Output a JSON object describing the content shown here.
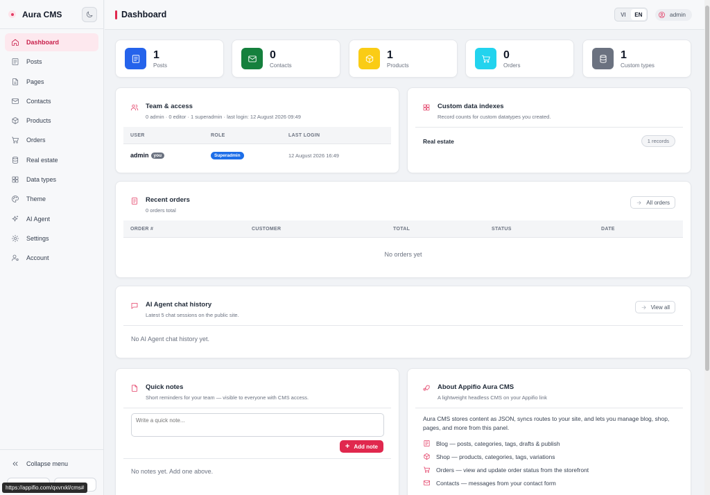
{
  "app": {
    "name": "Aura CMS"
  },
  "sidebar": {
    "items": [
      {
        "label": "Dashboard",
        "icon": "home-icon",
        "active": true
      },
      {
        "label": "Posts",
        "icon": "posts-icon"
      },
      {
        "label": "Pages",
        "icon": "page-icon"
      },
      {
        "label": "Contacts",
        "icon": "mail-icon"
      },
      {
        "label": "Products",
        "icon": "box-icon"
      },
      {
        "label": "Orders",
        "icon": "cart-icon"
      },
      {
        "label": "Real estate",
        "icon": "database-icon"
      },
      {
        "label": "Data types",
        "icon": "grid-icon"
      },
      {
        "label": "Theme",
        "icon": "palette-icon"
      },
      {
        "label": "AI Agent",
        "icon": "sparkle-icon"
      },
      {
        "label": "Settings",
        "icon": "gear-icon"
      },
      {
        "label": "Account",
        "icon": "user-gear-icon"
      }
    ],
    "collapse_label": "Collapse menu"
  },
  "status_url": "https://appifio.com/qxvrxkl/cms#",
  "header": {
    "title": "Dashboard",
    "lang_vi": "VI",
    "lang_en": "EN",
    "user": "admin"
  },
  "stats": [
    {
      "value": "1",
      "label": "Posts",
      "color": "#2563eb",
      "icon": "posts-icon"
    },
    {
      "value": "0",
      "label": "Contacts",
      "color": "#15803d",
      "icon": "mail-icon"
    },
    {
      "value": "1",
      "label": "Products",
      "color": "#facc15",
      "icon": "box-icon"
    },
    {
      "value": "0",
      "label": "Orders",
      "color": "#22d3ee",
      "icon": "cart-icon"
    },
    {
      "value": "1",
      "label": "Custom types",
      "color": "#6b7280",
      "icon": "database-icon"
    }
  ],
  "team": {
    "title": "Team & access",
    "subtitle": "0 admin · 0 editor · 1 superadmin · last login: 12 August 2026 09:49",
    "columns": [
      "USER",
      "ROLE",
      "LAST LOGIN"
    ],
    "row": {
      "user": "admin",
      "you": "you",
      "role": "Superadmin",
      "last_login": "12 August 2026 16:49"
    }
  },
  "indexes": {
    "title": "Custom data indexes",
    "subtitle": "Record counts for custom datatypes you created.",
    "row": {
      "name": "Real estate",
      "count": "1 records"
    }
  },
  "orders": {
    "title": "Recent orders",
    "subtitle": "0 orders total",
    "button": "All orders",
    "columns": [
      "ORDER #",
      "CUSTOMER",
      "TOTAL",
      "STATUS",
      "DATE"
    ],
    "empty": "No orders yet"
  },
  "chat": {
    "title": "AI Agent chat history",
    "subtitle": "Latest 5 chat sessions on the public site.",
    "button": "View all",
    "empty": "No AI Agent chat history yet."
  },
  "notes": {
    "title": "Quick notes",
    "subtitle": "Short reminders for your team — visible to everyone with CMS access.",
    "placeholder": "Write a quick note...",
    "add_label": "Add note",
    "empty": "No notes yet. Add one above."
  },
  "about": {
    "title": "About Appifio Aura CMS",
    "subtitle": "A lightweight headless CMS on your Appifio link",
    "body": "Aura CMS stores content as JSON, syncs routes to your site, and lets you manage blog, shop, pages, and more from this panel.",
    "features": [
      {
        "text": "Blog — posts, categories, tags, drafts & publish",
        "icon": "posts-icon"
      },
      {
        "text": "Shop — products, categories, tags, variations",
        "icon": "box-icon"
      },
      {
        "text": "Orders — view and update order status from the storefront",
        "icon": "cart-icon"
      },
      {
        "text": "Contacts — messages from your contact form",
        "icon": "mail-icon"
      }
    ]
  },
  "colors": {
    "accent": "#e0284e",
    "badge_blue": "#2563eb"
  }
}
